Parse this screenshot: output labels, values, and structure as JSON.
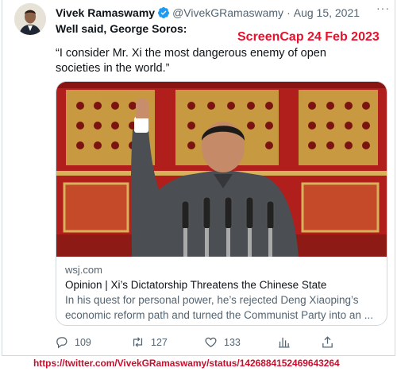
{
  "tweet": {
    "author_name": "Vivek Ramaswamy",
    "handle": "@VivekGRamaswamy",
    "separator": "·",
    "date": "Aug 15, 2021",
    "more_label": "···",
    "text_line": "Well said, George Soros:",
    "quote": "“I consider Mr. Xi the most dangerous enemy of open societies in the world.”"
  },
  "watermark": "ScreenCap 24 Feb 2023",
  "card": {
    "domain": "wsj.com",
    "title": "Opinion | Xi’s Dictatorship Threatens the Chinese State",
    "description": "In his quest for personal power, he’s rejected Deng Xiaoping’s economic reform path and turned the Communist Party into an ..."
  },
  "actions": {
    "replies": "109",
    "retweets": "127",
    "likes": "133",
    "reply_icon": "reply-icon",
    "retweet_icon": "retweet-icon",
    "like_icon": "heart-icon",
    "analytics_icon": "analytics-icon",
    "share_icon": "share-icon"
  },
  "source_url": "https://twitter.com/VivekGRamaswamy/status/1426884152469643264",
  "colors": {
    "verified_blue": "#1d9bf0",
    "text_primary": "#0f1419",
    "text_secondary": "#536471",
    "watermark_red": "#e8102a",
    "url_red": "#c8102e",
    "border": "#cfd9de"
  }
}
